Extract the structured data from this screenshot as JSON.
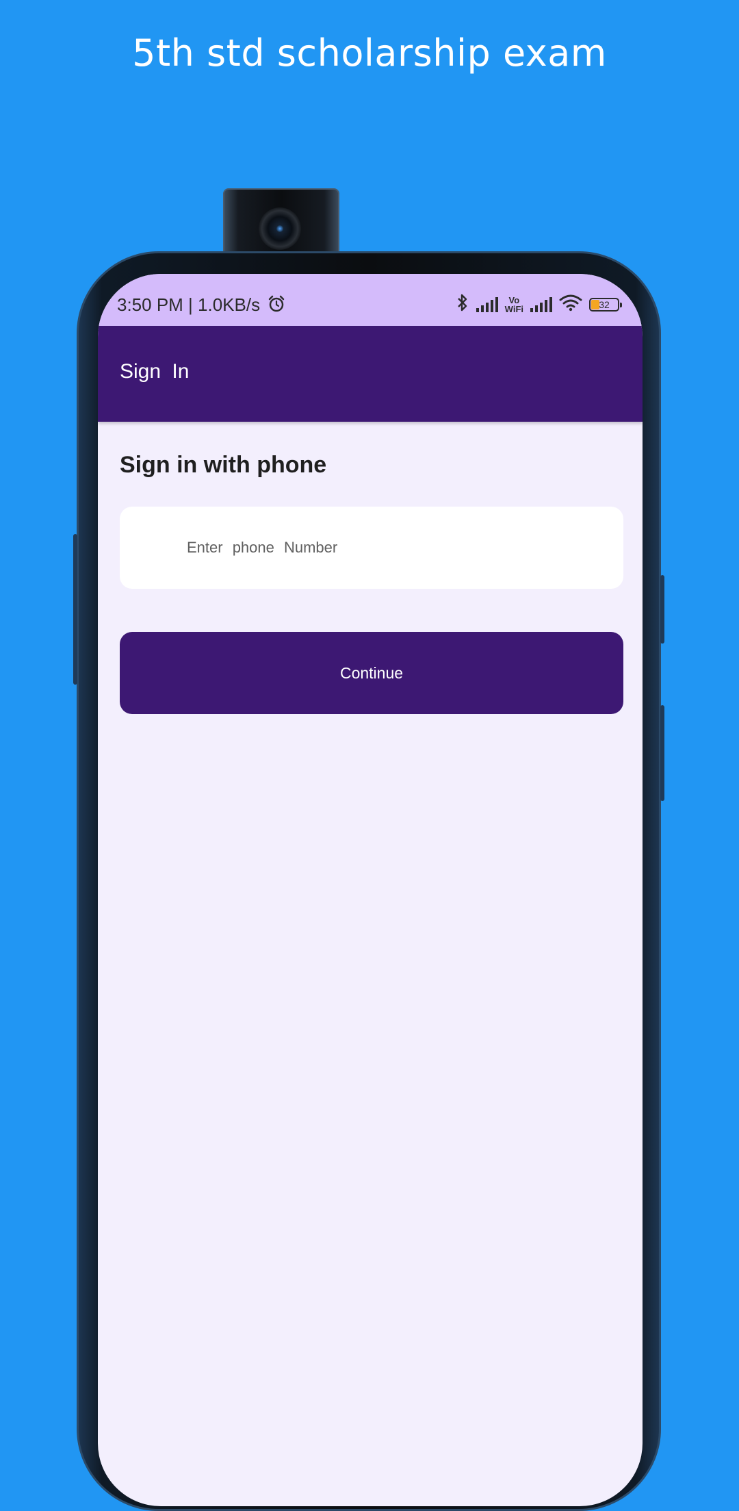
{
  "promo": {
    "headline": "5th std scholarship exam"
  },
  "status_bar": {
    "time_speed": "3:50 PM | 1.0KB/s",
    "icons": [
      "alarm-icon",
      "bluetooth-icon",
      "signal-icon",
      "vowifi-icon",
      "signal-icon",
      "wifi-icon",
      "battery-icon"
    ],
    "vowifi_top": "Vo",
    "vowifi_bottom": "WiFi",
    "battery_level": "32"
  },
  "appbar": {
    "title": "Sign In"
  },
  "main": {
    "heading": "Sign in with phone",
    "phone_field": {
      "placeholder": "Enter phone Number",
      "value": ""
    },
    "continue_label": "Continue"
  },
  "colors": {
    "background": "#2196F3",
    "status_bar": "#D4BBFB",
    "primary": "#3D1873",
    "screen_bg": "#F3EFFD",
    "battery_fill": "#F5A623"
  }
}
